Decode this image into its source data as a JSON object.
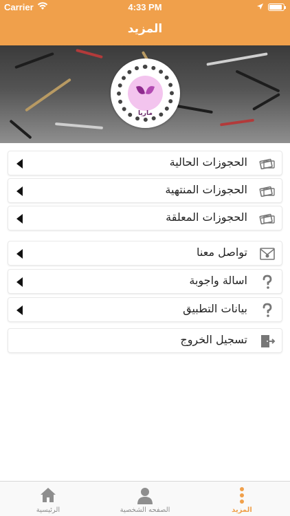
{
  "status_bar": {
    "carrier": "Carrier",
    "time": "4:33 PM"
  },
  "header": {
    "title": "المزيد"
  },
  "profile": {
    "logo_text": "ماريا"
  },
  "menu": {
    "items": [
      {
        "label": "الحجوزات الحالية",
        "icon": "card-icon"
      },
      {
        "label": "الحجوزات المنتهية",
        "icon": "card-icon"
      },
      {
        "label": "الحجوزات المعلقة",
        "icon": "card-icon"
      },
      {
        "label": "تواصل معنا",
        "icon": "envelope-icon"
      },
      {
        "label": "اسالة واجوبة",
        "icon": "question-icon"
      },
      {
        "label": "بيانات التطبيق",
        "icon": "question-icon"
      },
      {
        "label": "تسجيل الخروج",
        "icon": "logout-icon"
      }
    ]
  },
  "tab_bar": {
    "tabs": [
      {
        "label": "الرئيسية",
        "icon": "home-icon",
        "active": false
      },
      {
        "label": "الصفحه الشخصية",
        "icon": "person-icon",
        "active": false
      },
      {
        "label": "المزيد",
        "icon": "more-dots-icon",
        "active": true
      }
    ]
  },
  "colors": {
    "accent": "#F0A04B",
    "icon_gray": "#777777",
    "text": "#222222"
  }
}
